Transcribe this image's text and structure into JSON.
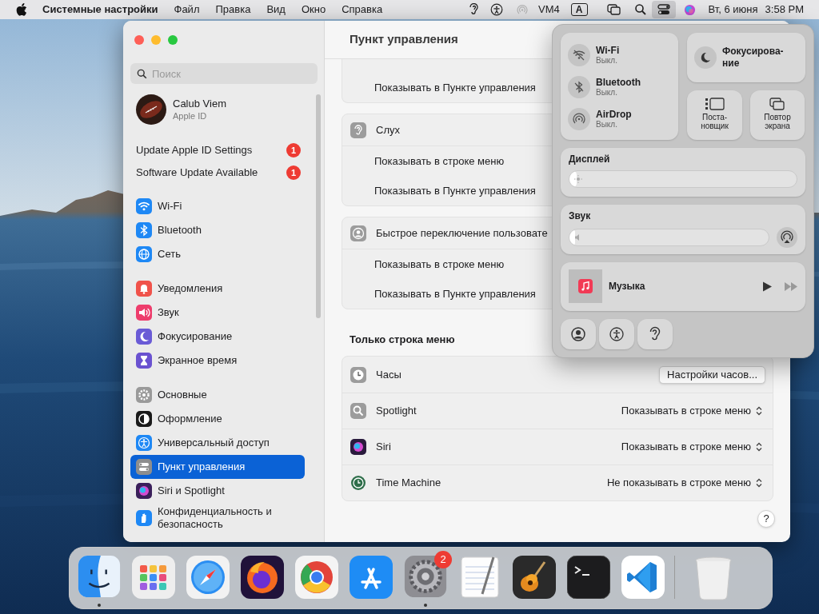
{
  "menu_bar": {
    "app_name": "Системные настройки",
    "menus": [
      "Файл",
      "Правка",
      "Вид",
      "Окно",
      "Справка"
    ],
    "user_label": "VM4",
    "input_source": "A",
    "control_center_active": true,
    "date": "Вт, 6 июня",
    "time": "3:58 PM"
  },
  "window": {
    "title": "Пункт управления",
    "search": {
      "placeholder": "Поиск"
    },
    "account": {
      "name": "Calub Viem",
      "subtitle": "Apple ID"
    },
    "notices": [
      {
        "label": "Update Apple ID Settings",
        "badge": "1"
      },
      {
        "label": "Software Update Available",
        "badge": "1"
      }
    ],
    "sidebar": {
      "groups": [
        {
          "items": [
            {
              "label": "Wi-Fi",
              "color": "#1e88f5",
              "selected": false
            },
            {
              "label": "Bluetooth",
              "color": "#1e88f5",
              "selected": false
            },
            {
              "label": "Сеть",
              "color": "#1e88f5",
              "selected": false
            }
          ]
        },
        {
          "items": [
            {
              "label": "Уведомления",
              "color": "#f0524a",
              "selected": false
            },
            {
              "label": "Звук",
              "color": "#ee3d6c",
              "selected": false
            },
            {
              "label": "Фокусирование",
              "color": "#6a5bd6",
              "selected": false
            },
            {
              "label": "Экранное время",
              "color": "#6a52d0",
              "selected": false
            }
          ]
        },
        {
          "items": [
            {
              "label": "Основные",
              "color": "#9a9a9a",
              "selected": false
            },
            {
              "label": "Оформление",
              "color": "#1a1a1a",
              "selected": false
            },
            {
              "label": "Универсальный доступ",
              "color": "#1e88f5",
              "selected": false
            },
            {
              "label": "Пункт управления",
              "color": "#8e8e8e",
              "selected": true
            },
            {
              "label": "Siri и Spotlight",
              "color": "#3a1f5a",
              "selected": false
            },
            {
              "label": "Конфиденциальность и безопасность",
              "color": "#1e88f5",
              "selected": false
            }
          ]
        }
      ]
    },
    "content": {
      "groups": [
        {
          "rows": [
            "Показывать в Пункте управления"
          ]
        },
        {
          "title": "Слух",
          "rows": [
            "Показывать в строке меню",
            "Показывать в Пункте управления"
          ]
        },
        {
          "title": "Быстрое переключение пользовате",
          "rows": [
            "Показывать в строке меню",
            "Показывать в Пункте управления"
          ]
        }
      ],
      "menu_bar_only": {
        "title": "Только строка меню",
        "rows": [
          {
            "label": "Часы",
            "kind": "button",
            "control": "Настройки часов..."
          },
          {
            "label": "Spotlight",
            "kind": "popup",
            "control": "Показывать в строке меню"
          },
          {
            "label": "Siri",
            "kind": "popup",
            "control": "Показывать в строке меню"
          },
          {
            "label": "Time Machine",
            "kind": "popup",
            "control": "Не показывать в строке меню"
          }
        ]
      },
      "help": "?"
    }
  },
  "control_center": {
    "connectivity": [
      {
        "label": "Wi-Fi",
        "status": "Выкл.",
        "on": false
      },
      {
        "label": "Bluetooth",
        "status": "Выкл.",
        "on": false
      },
      {
        "label": "AirDrop",
        "status": "Выкл.",
        "on": false
      }
    ],
    "focus": {
      "lines": [
        "Фокусирова-",
        "ние"
      ]
    },
    "stage_manager": {
      "lines": [
        "Поста-",
        "новщик"
      ]
    },
    "screen_mirroring": {
      "lines": [
        "Повтор",
        "экрана"
      ]
    },
    "display": {
      "label": "Дисплей",
      "level": 0.03
    },
    "sound": {
      "label": "Звук",
      "level": 0.03
    },
    "now_playing": {
      "app": "Музыка"
    }
  },
  "dock": {
    "apps": [
      {
        "running": true
      },
      {
        "running": false
      },
      {
        "running": false
      },
      {
        "running": false
      },
      {
        "running": false
      },
      {
        "running": false
      },
      {
        "running": true,
        "badge": "2"
      },
      {
        "running": false
      },
      {
        "running": false
      },
      {
        "running": false
      },
      {
        "running": false
      }
    ]
  }
}
